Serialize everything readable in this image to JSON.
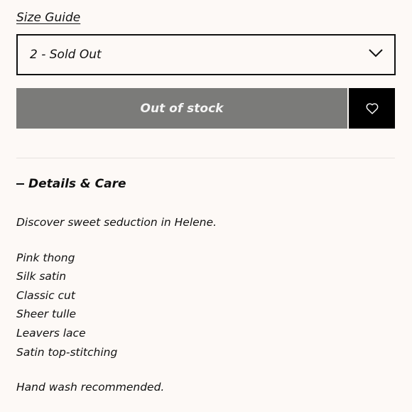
{
  "size_guide": {
    "label": "Size Guide"
  },
  "size_select": {
    "value": "2 - Sold Out",
    "icon": "chevron-down-icon"
  },
  "actions": {
    "add_label": "Out of stock",
    "wishlist_icon": "heart-icon",
    "disabled_color": "#7b7b79",
    "wishlist_color": "#000000"
  },
  "details": {
    "title": "Details & Care",
    "intro": "Discover sweet seduction in Helene.",
    "features": [
      "Pink thong",
      "Silk satin",
      "Classic cut",
      "Sheer tulle",
      "Leavers lace",
      "Satin top-stitching"
    ],
    "care": "Hand wash recommended."
  },
  "colors": {
    "background": "#fdf9f6",
    "text": "#111111"
  }
}
